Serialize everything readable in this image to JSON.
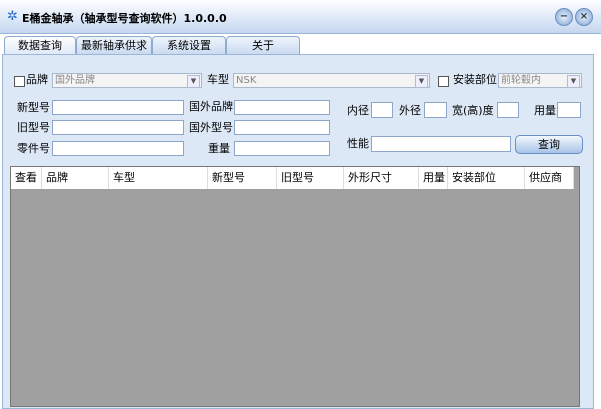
{
  "window": {
    "title": "E桶金轴承（轴承型号查询软件）1.0.0.0",
    "minimize": "−",
    "close": "×"
  },
  "tabs": [
    {
      "label": "数据查询"
    },
    {
      "label": "最新轴承供求"
    },
    {
      "label": "系统设置"
    },
    {
      "label": "关于"
    }
  ],
  "form": {
    "brand_label": "品牌",
    "brand_value": "国外品牌",
    "car_label": "车型",
    "car_value": "NSK",
    "position_label": "安装部位",
    "position_value": "前轮毂内",
    "new_model_label": "新型号",
    "old_model_label": "旧型号",
    "part_no_label": "零件号",
    "foreign_brand_label": "国外品牌",
    "foreign_model_label": "国外型号",
    "weight_label": "重量",
    "inner_label": "内径",
    "outer_label": "外径",
    "width_label": "宽(高)度",
    "qty_label": "用量",
    "perf_label": "性能",
    "query_button": "查询"
  },
  "grid": {
    "columns": [
      "查看",
      "品牌",
      "车型",
      "新型号",
      "旧型号",
      "外形尺寸",
      "用量",
      "安装部位",
      "供应商"
    ],
    "rows": []
  }
}
